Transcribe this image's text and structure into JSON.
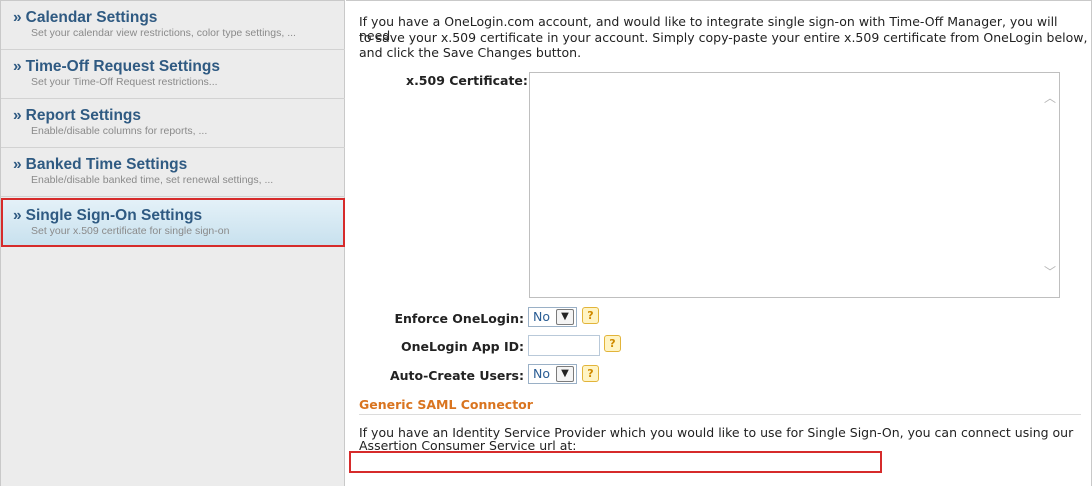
{
  "sidebar": {
    "items": [
      {
        "arrows": "»",
        "label": "Calendar Settings",
        "sub": "Set your calendar view restrictions, color type settings, ..."
      },
      {
        "arrows": "»",
        "label": "Time-Off Request Settings",
        "sub": "Set your Time-Off Request restrictions..."
      },
      {
        "arrows": "»",
        "label": "Report Settings",
        "sub": "Enable/disable columns for reports, ..."
      },
      {
        "arrows": "»",
        "label": "Banked Time Settings",
        "sub": "Enable/disable banked time, set renewal settings, ..."
      },
      {
        "arrows": "»",
        "label": "Single Sign-On Settings",
        "sub": "Set your x.509 certificate for single sign-on"
      }
    ]
  },
  "main": {
    "intro_line1": "If you have a OneLogin.com account, and would like to integrate single sign-on with Time-Off Manager, you will need",
    "intro_line2": "to save your x.509 certificate in your account. Simply copy-paste your entire x.509 certificate from OneLogin below,",
    "intro_line3": "and click the Save Changes button.",
    "certificate_label": "x.509 Certificate:",
    "certificate_value": "",
    "enforce_label": "Enforce OneLogin:",
    "enforce_value": "No",
    "app_id_label": "OneLogin App ID:",
    "app_id_value": "",
    "auto_create_label": "Auto-Create Users:",
    "auto_create_value": "No",
    "help_glyph": "?",
    "generic_title": "Generic SAML Connector",
    "generic_line1": "If you have an Identity Service Provider which you would like to use for Single Sign-On, you can connect using our",
    "generic_line2": "Assertion Consumer Service url at:"
  },
  "colors": {
    "accent_blue": "#2f5a82",
    "section_orange": "#d9741f",
    "highlight_red": "#d62b2b"
  }
}
